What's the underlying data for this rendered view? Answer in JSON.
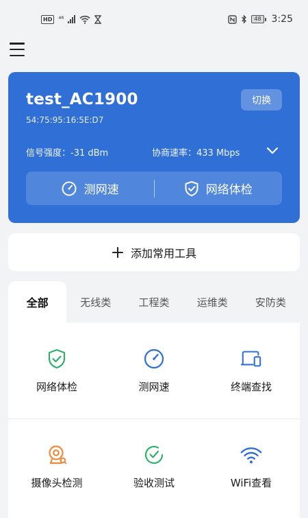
{
  "status_bar": {
    "hd": "HD",
    "network": "⁴⁶",
    "battery": "48",
    "time": "3:25"
  },
  "device": {
    "name": "test_AC1900",
    "mac": "54:75:95:16:5E:D7",
    "switch_label": "切换",
    "signal": "信号强度：-31 dBm",
    "rate": "协商速率：433 Mbps",
    "actions": {
      "speed_test": "测网速",
      "network_check": "网络体检"
    }
  },
  "add_tools_label": "添加常用工具",
  "tabs": [
    "全部",
    "无线类",
    "工程类",
    "运维类",
    "安防类"
  ],
  "tools": [
    {
      "label": "网络体检",
      "icon": "shield-check-icon",
      "color": "#2fb06a"
    },
    {
      "label": "测网速",
      "icon": "speedometer-icon",
      "color": "#2f6fd6"
    },
    {
      "label": "终端查找",
      "icon": "devices-icon",
      "color": "#2f6fd6"
    },
    {
      "label": "摄像头检测",
      "icon": "camera-icon",
      "color": "#f08a3c"
    },
    {
      "label": "验收测试",
      "icon": "check-circle-icon",
      "color": "#2fb06a"
    },
    {
      "label": "WiFi查看",
      "icon": "wifi-icon",
      "color": "#2f6fd6"
    }
  ],
  "colors": {
    "primary": "#2f6fd6",
    "green": "#2fb06a",
    "orange": "#f08a3c",
    "background": "#f1f3f5"
  }
}
